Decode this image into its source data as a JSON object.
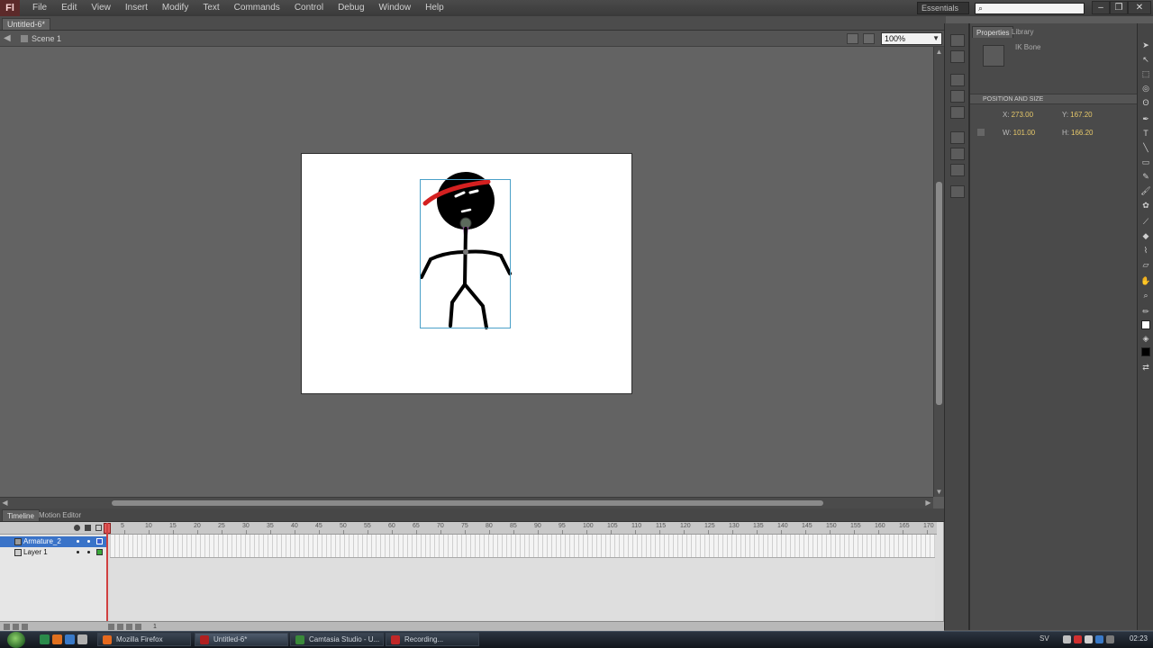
{
  "app": {
    "logo": "Fl",
    "menus": [
      "File",
      "Edit",
      "View",
      "Insert",
      "Modify",
      "Text",
      "Commands",
      "Control",
      "Debug",
      "Window",
      "Help"
    ],
    "workspace": "Essentials",
    "search_placeholder": "",
    "window_controls": [
      "minimize",
      "restore",
      "close"
    ]
  },
  "document": {
    "tab": "Untitled-6*",
    "scene": "Scene 1",
    "zoom": "100%"
  },
  "timeline": {
    "tabs": [
      "Timeline",
      "Motion Editor"
    ],
    "ruler": [
      "5",
      "10",
      "15",
      "20",
      "25",
      "30",
      "35",
      "40",
      "45",
      "50",
      "55",
      "60",
      "65",
      "70",
      "75",
      "80",
      "85",
      "90",
      "95",
      "100",
      "105",
      "110",
      "115",
      "120",
      "125",
      "130",
      "135",
      "140",
      "145",
      "150",
      "155",
      "160",
      "165",
      "170"
    ],
    "layers": [
      {
        "name": "Armature_2",
        "selected": true,
        "color": "#3b5fd0"
      },
      {
        "name": "Layer 1",
        "selected": false,
        "color": "#3aa83a"
      }
    ],
    "current_frame": "1"
  },
  "properties": {
    "tabs": [
      "Properties",
      "Library"
    ],
    "instance_label": "IK Bone",
    "section": "POSITION AND SIZE",
    "x_label": "X:",
    "x": "273.00",
    "y_label": "Y:",
    "y": "167.20",
    "w_label": "W:",
    "w": "101.00",
    "h_label": "H:",
    "h": "166.20"
  },
  "taskbar": {
    "tasks": [
      {
        "label": "Mozilla Firefox",
        "color": "#e66a1f"
      },
      {
        "label": "Untitled-6*",
        "color": "#b02020"
      },
      {
        "label": "Camtasia Studio - U...",
        "color": "#3a8a3a"
      },
      {
        "label": "Recording...",
        "color": "#c02828"
      }
    ],
    "clock": "02:23",
    "lang": "SV"
  },
  "colors": {
    "stage_bg": "#ffffff",
    "pasteboard": "#636363",
    "selection": "#4aa0c8",
    "headband": "#d42020",
    "bone": "#8a4f96"
  }
}
